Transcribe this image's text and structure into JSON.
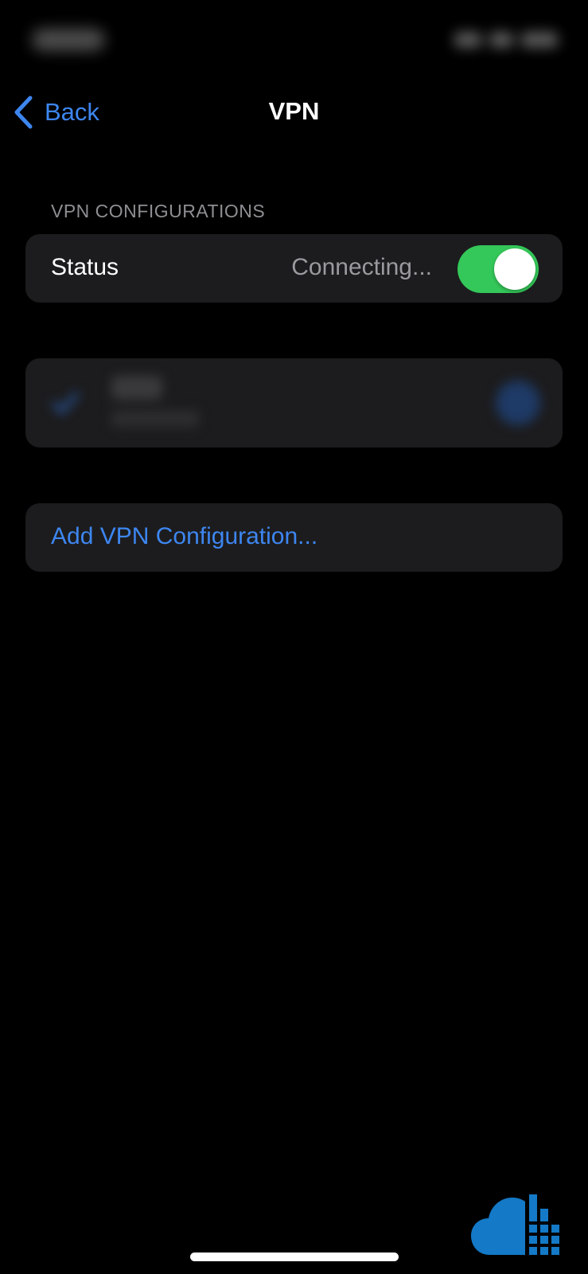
{
  "nav": {
    "back_label": "Back",
    "title": "VPN"
  },
  "section": {
    "header": "VPN CONFIGURATIONS"
  },
  "status_row": {
    "label": "Status",
    "value": "Connecting...",
    "toggle_on": true
  },
  "add_row": {
    "label": "Add VPN Configuration..."
  },
  "icons": {
    "back": "chevron-left-icon",
    "check": "checkmark-icon",
    "info": "info-icon",
    "logo": "cloud-logo-icon"
  },
  "colors": {
    "background": "#000000",
    "card": "#1c1c1e",
    "accent_blue": "#3d86f0",
    "toggle_green": "#34c759",
    "secondary_text": "#8e8e93",
    "logo_blue": "#1479c6"
  }
}
